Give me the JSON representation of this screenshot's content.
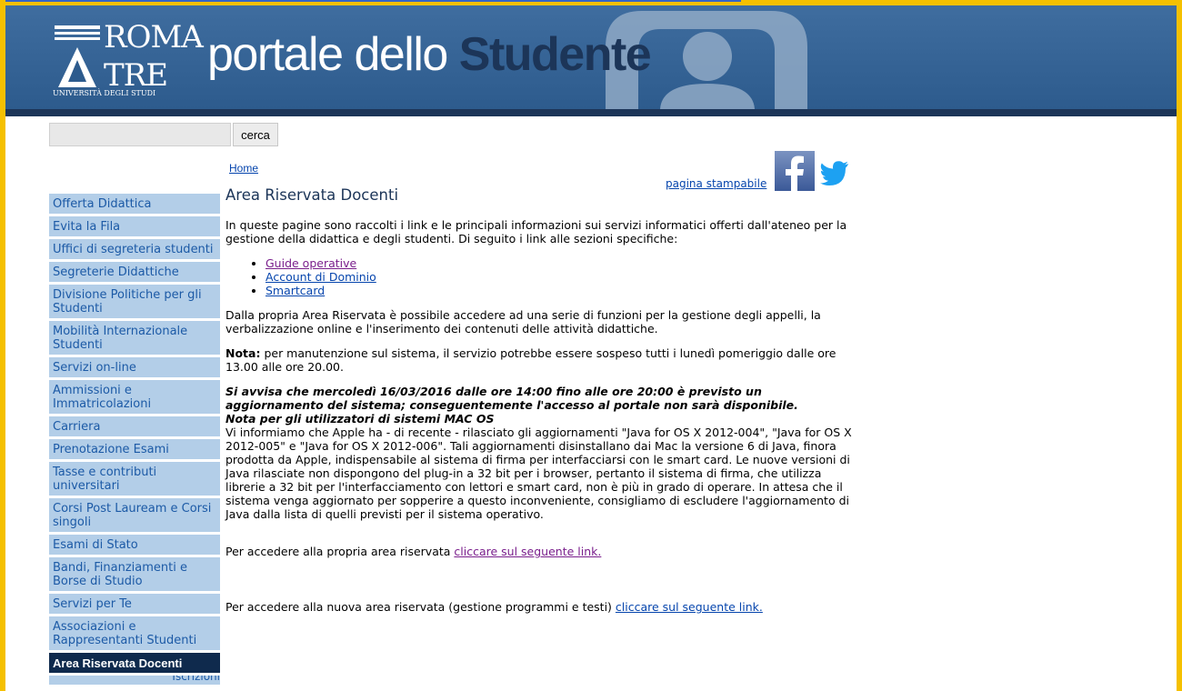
{
  "colors": {
    "frame": "#f5c000",
    "header_bg": "#2d5b8d",
    "header_dark": "#1c3558",
    "sidebar_bg": "#b3cee8",
    "sidebar_active_bg": "#0f2a4d",
    "link": "#0645ad",
    "visited_link": "#7a1f8c"
  },
  "header": {
    "logo_line1": "ROMA",
    "logo_line2": "TRE",
    "logo_subline": "UNIVERSITÀ DEGLI STUDI",
    "title_part1": "portale dello ",
    "title_part2": "Studente",
    "avatar_icon": "user-silhouette-icon"
  },
  "search": {
    "placeholder": "",
    "value": "",
    "button_label": "cerca"
  },
  "breadcrumb": {
    "home": "Home"
  },
  "tools": {
    "print_label": "pagina stampabile",
    "facebook_icon": "facebook-icon",
    "twitter_icon": "twitter-icon"
  },
  "sidebar": {
    "items": [
      {
        "label": "Offerta Didattica"
      },
      {
        "label": "Evita la Fila"
      },
      {
        "label": "Uffici di segreteria studenti"
      },
      {
        "label": "Segreterie Didattiche"
      },
      {
        "label": "Divisione Politiche per gli Studenti"
      },
      {
        "label": "Mobilità Internazionale Studenti"
      },
      {
        "label": "Servizi on-line"
      },
      {
        "label": "Ammissioni e Immatricolazioni"
      },
      {
        "label": "Carriera"
      },
      {
        "label": "Prenotazione Esami"
      },
      {
        "label": "Tasse e contributi universitari"
      },
      {
        "label": "Corsi Post Lauream e Corsi singoli"
      },
      {
        "label": "Esami di Stato"
      },
      {
        "label": "Bandi, Finanziamenti e Borse di Studio"
      },
      {
        "label": "Servizi per Te"
      },
      {
        "label": "Associazioni e Rappresentanti Studenti"
      },
      {
        "label": "Area Riservata Docenti"
      },
      {
        "label": "Iscrizioni"
      }
    ]
  },
  "content": {
    "title": "Area Riservata Docenti",
    "intro": "In queste pagine sono raccolti i link e le principali informazioni sui servizi informatici offerti dall'ateneo per la gestione della didattica e degli studenti. Di seguito i link alle sezioni specifiche:",
    "links": [
      "Guide operative",
      "Account di Dominio",
      "Smartcard"
    ],
    "para2": "Dalla propria Area Riservata è possibile accedere ad una serie di funzioni per la gestione degli appelli, la verbalizzazione online e l'inserimento dei contenuti delle attività didattiche.",
    "nota_label": "Nota:",
    "nota_text": " per manutenzione sul sistema, il servizio potrebbe essere sospeso tutti i lunedì pomeriggio dalle ore 13.00 alle ore 20.00.",
    "notice_bold": "Si avvisa che mercoledì 16/03/2016 dalle ore 14:00 fino alle ore 20:00 è previsto un aggiornamento del sistema; conseguentemente l'accesso al portale non sarà disponibile.",
    "mac_title": "Nota per gli utilizzatori di sistemi MAC OS",
    "mac_text": "Vi informiamo che Apple ha - di recente - rilasciato gli aggiornamenti \"Java for OS X 2012-004\", \"Java for OS X 2012-005\" e \"Java for OS X 2012-006\". Tali aggiornamenti disinstallano dai Mac la versione 6 di Java, finora prodotta da Apple, indispensabile al sistema di firma per interfacciarsi con le smart card. Le nuove versioni di Java rilasciate non dispongono del plug-in a 32 bit per i browser, pertanto il sistema di firma, che utilizza librerie a 32 bit per l'interfacciamento con lettori e smart card, non è più in grado di operare. In attesa che il sistema venga aggiornato per sopperire a questo inconveniente, consigliamo di escludere l'aggiornamento di Java dalla lista di quelli previsti per il sistema operativo.",
    "access1_text": "Per accedere alla propria area riservata ",
    "access1_link": "cliccare sul seguente link.",
    "access2_text": "Per accedere alla nuova area riservata (gestione programmi e testi) ",
    "access2_link": "cliccare sul seguente link."
  }
}
